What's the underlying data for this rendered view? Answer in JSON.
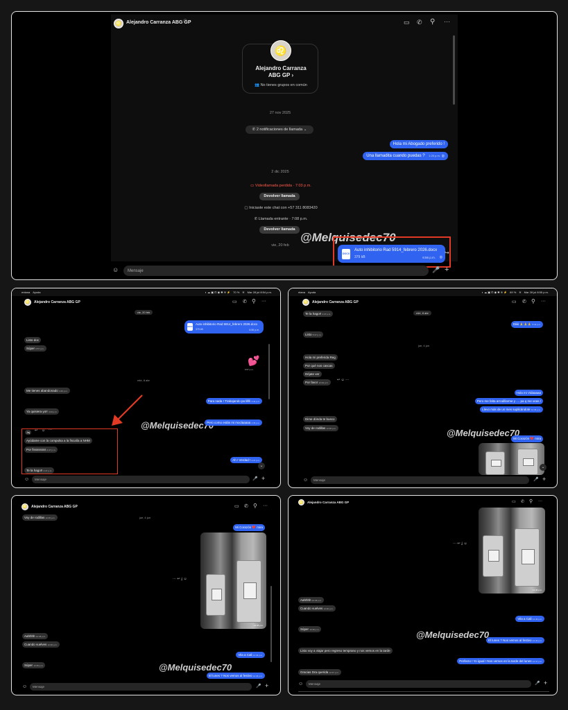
{
  "contact": {
    "name": "Alejandro Carranza ABG GP",
    "verified_icon": "verified-icon",
    "profile_name": "Alejandro Carranza\nABG GP",
    "profile_name_line1": "Alejandro Carranza",
    "profile_name_line2": "ABG GP",
    "profile_link_icon": "chevron-right-icon",
    "common_groups": "No tienes grupos en común"
  },
  "header_icons": [
    "video-call-icon",
    "phone-icon",
    "search-icon",
    "more-icon"
  ],
  "input": {
    "placeholder": "Mensaje"
  },
  "watermark": "@Melquisedec70",
  "colors": {
    "outgoing": "#2f63f0",
    "incoming": "#303030",
    "annotation": "#e23a24"
  },
  "menubar": {
    "left": {
      "app": "entana",
      "menu": "Ayuda"
    },
    "right": {
      "app": "ntana",
      "menu": "Ayuda"
    },
    "battery_left": "70 %",
    "battery_right": "69 %",
    "clock_left": "Mar 28 jul 8:54 p.m.",
    "clock_right": "Mar 28 jul 8:55 p.m."
  },
  "panel1": {
    "date1": "27 nov 2025",
    "call_notif": "2 notificaciones de llamada",
    "msg1": "Hola mi Abogado preferido !",
    "msg2": "Una llamadita cuando puedas ?",
    "msg2_time": "1:20 p.m.",
    "date2": "2 dic 2025",
    "missed_video": "Videollamada perdida · 7:03 p.m.",
    "return_call": "Devolver llamada",
    "started_chat": "Iniciaste este chat con +57 311 8083420",
    "incoming_call": "Llamada entrante · 7:08 p.m.",
    "return_call2": "Devolver llamada",
    "date3": "vie, 20 feb",
    "doc_name": "Auto inhibitorio Rad 5914_febrero 2026.docx",
    "doc_size": "379 kB",
    "doc_time": "6:56 p.m.",
    "doc_type": "DOCX"
  },
  "panel2": {
    "date1": "vie, 20 feb",
    "doc_name": "Auto inhibitorio Rad 5914_febrero 2026.docx",
    "doc_size": "379 kB",
    "doc_time": "6:56 p.m.",
    "in1": "Listo doc",
    "in1_time": "6:57 p.m.",
    "in2": "Súper",
    "in2_time": "6:57 p.m.",
    "sticker": "💕",
    "sticker_time": "6:57 p.m.",
    "date2": "mié, 8 abr",
    "in3": "Me tienes abandonado",
    "in3_time": "4:40 p.m.",
    "out1": "Para nada ! Trabajando pa lilllli",
    "out1_time": "4:44 p.m.",
    "in4": "Ya quisiera yo!!",
    "in4_time": "4:44 p.m.",
    "out2": "Pero como estás mi moclaaaaa",
    "out2_time": "4:45 p.m.",
    "reaction": "Jaj",
    "in5": "Ayúdame con la compulsa a la fiscalía a NHM",
    "in6": "Por fissssssss",
    "in6_time": "4:47 p.m.",
    "out3": "Ah ! Verdad !",
    "out3_time": "4:47 p.m.",
    "in7": "Te la hago!!",
    "in7_time": "4:47 p.m."
  },
  "panel3": {
    "in1": "Te la hago!!",
    "in1_time": "4:47 p.m.",
    "date1": "mié, 8 abr",
    "out1": "Diiiii 🙏🙏🙏",
    "out1_time": "5:44 p.m.",
    "in2": "Listo",
    "in2_time": "5:37 p.m.",
    "date2": "jue, 4 jun",
    "in3": "Hola mi preferida Reg",
    "in4": "Por qué nos cascas",
    "in5": "Déjate ver",
    "in6": "Por favor",
    "in6_time": "12:44 p.m.",
    "out2": "Hola mi Vidaaaaa",
    "out3": "Pero me falta arrodillarme y .... pa q me veas !",
    "out4": "Llevo más de un mes suplicándote",
    "out4_time": "12:45 p.m.",
    "in7": "Dime dónda te busco",
    "in8": "Voy de rodillas",
    "in8_time": "12:45 p.m.",
    "out5": "Mi Corazón ❤️ mira"
  },
  "panel4": {
    "in1": "Voy de rodillas",
    "in1_time": "12:45 p.m.",
    "date1": "jue, 4 jun",
    "out1": "Mi Corazón ❤️ mira",
    "photo_time": "12:45 p.m.",
    "in2": "Aahhhh",
    "in2_time": "12:46 p.m.",
    "in3": "Cuando vuelves",
    "in3_time": "12:46 p.m.",
    "out2": "Vila a Cali",
    "out2_time": "12:46 p.m.",
    "in4": "Súper",
    "in4_time": "12:46 p.m.",
    "out3": "El lunes ? Nos vemos al festivo",
    "out3_time": "12:46 p.m."
  },
  "panel5": {
    "photo_time": "12:45 p.m.",
    "in1": "Aahhhh",
    "in1_time": "12:46 p.m.",
    "in2": "Cuando vuelves",
    "in2_time": "12:46 p.m.",
    "out1": "Vila a Cali",
    "out1_time": "12:46 p.m.",
    "in3": "Súper",
    "in3_time": "12:46 p.m.",
    "out2": "El lunes ? Nos vemos al festivo",
    "out2_time": "12:46 p.m.",
    "in4": "Listo voy a viajar pero regreso temprano y nos vemos en la tarde",
    "out3": "Perfecto ! Yo igual ! Nos vemos en la tarde del lunes",
    "out3_time": "12:47 p.m.",
    "in5": "Gracias Dra querida",
    "in5_time": "12:47 p.m."
  }
}
